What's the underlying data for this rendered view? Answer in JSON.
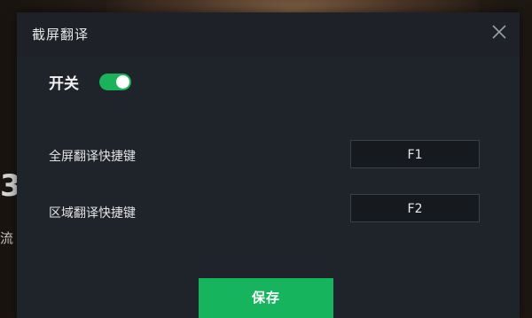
{
  "dialog": {
    "title": "截屏翻译",
    "close_icon": "close-icon"
  },
  "toggle": {
    "label": "开关",
    "state": "on",
    "accent_color": "#1ab35a"
  },
  "shortcuts": [
    {
      "label": "全屏翻译快捷键",
      "key": "F1"
    },
    {
      "label": "区域翻译快捷键",
      "key": "F2"
    }
  ],
  "save_button": {
    "label": "保存",
    "color": "#16b45c"
  },
  "background": {
    "left_glyph_1": "3",
    "left_glyph_2": "流"
  }
}
